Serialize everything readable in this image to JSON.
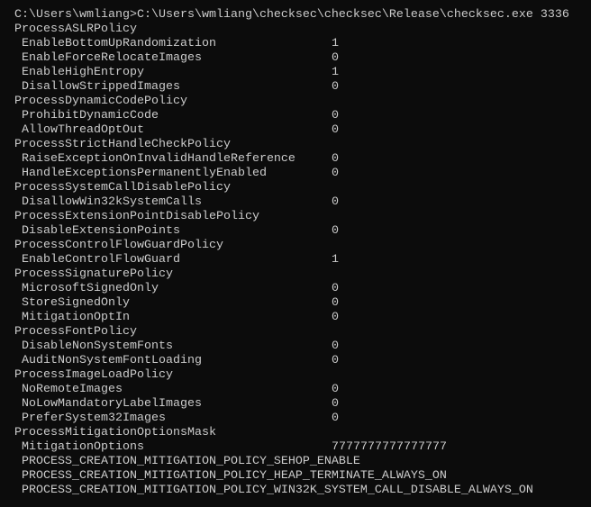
{
  "colors": {
    "background": "#0c0c0c",
    "text": "#cccccc"
  },
  "command_line": "C:\\Users\\wmliang>C:\\Users\\wmliang\\checksec\\checksec\\Release\\checksec.exe 3336",
  "policies": [
    {
      "name": "ProcessASLRPolicy",
      "items": [
        {
          "name": "EnableBottomUpRandomization",
          "value": "1"
        },
        {
          "name": "EnableForceRelocateImages",
          "value": "0"
        },
        {
          "name": "EnableHighEntropy",
          "value": "1"
        },
        {
          "name": "DisallowStrippedImages",
          "value": "0"
        }
      ]
    },
    {
      "name": "ProcessDynamicCodePolicy",
      "items": [
        {
          "name": "ProhibitDynamicCode",
          "value": "0"
        },
        {
          "name": "AllowThreadOptOut",
          "value": "0"
        }
      ]
    },
    {
      "name": "ProcessStrictHandleCheckPolicy",
      "items": [
        {
          "name": "RaiseExceptionOnInvalidHandleReference",
          "value": "0"
        },
        {
          "name": "HandleExceptionsPermanentlyEnabled",
          "value": "0"
        }
      ]
    },
    {
      "name": "ProcessSystemCallDisablePolicy",
      "items": [
        {
          "name": "DisallowWin32kSystemCalls",
          "value": "0"
        }
      ]
    },
    {
      "name": "ProcessExtensionPointDisablePolicy",
      "items": [
        {
          "name": "DisableExtensionPoints",
          "value": "0"
        }
      ]
    },
    {
      "name": "ProcessControlFlowGuardPolicy",
      "items": [
        {
          "name": "EnableControlFlowGuard",
          "value": "1"
        }
      ]
    },
    {
      "name": "ProcessSignaturePolicy",
      "items": [
        {
          "name": "MicrosoftSignedOnly",
          "value": "0"
        },
        {
          "name": "StoreSignedOnly",
          "value": "0"
        },
        {
          "name": "MitigationOptIn",
          "value": "0"
        }
      ]
    },
    {
      "name": "ProcessFontPolicy",
      "items": [
        {
          "name": "DisableNonSystemFonts",
          "value": "0"
        },
        {
          "name": "AuditNonSystemFontLoading",
          "value": "0"
        }
      ]
    },
    {
      "name": "ProcessImageLoadPolicy",
      "items": [
        {
          "name": "NoRemoteImages",
          "value": "0"
        },
        {
          "name": "NoLowMandatoryLabelImages",
          "value": "0"
        },
        {
          "name": "PreferSystem32Images",
          "value": "0"
        }
      ]
    },
    {
      "name": "ProcessMitigationOptionsMask",
      "items": [
        {
          "name": "MitigationOptions",
          "value": "7777777777777777"
        }
      ]
    }
  ],
  "mitigation_flags": [
    "PROCESS_CREATION_MITIGATION_POLICY_SEHOP_ENABLE",
    "PROCESS_CREATION_MITIGATION_POLICY_HEAP_TERMINATE_ALWAYS_ON",
    "PROCESS_CREATION_MITIGATION_POLICY_WIN32K_SYSTEM_CALL_DISABLE_ALWAYS_ON"
  ]
}
